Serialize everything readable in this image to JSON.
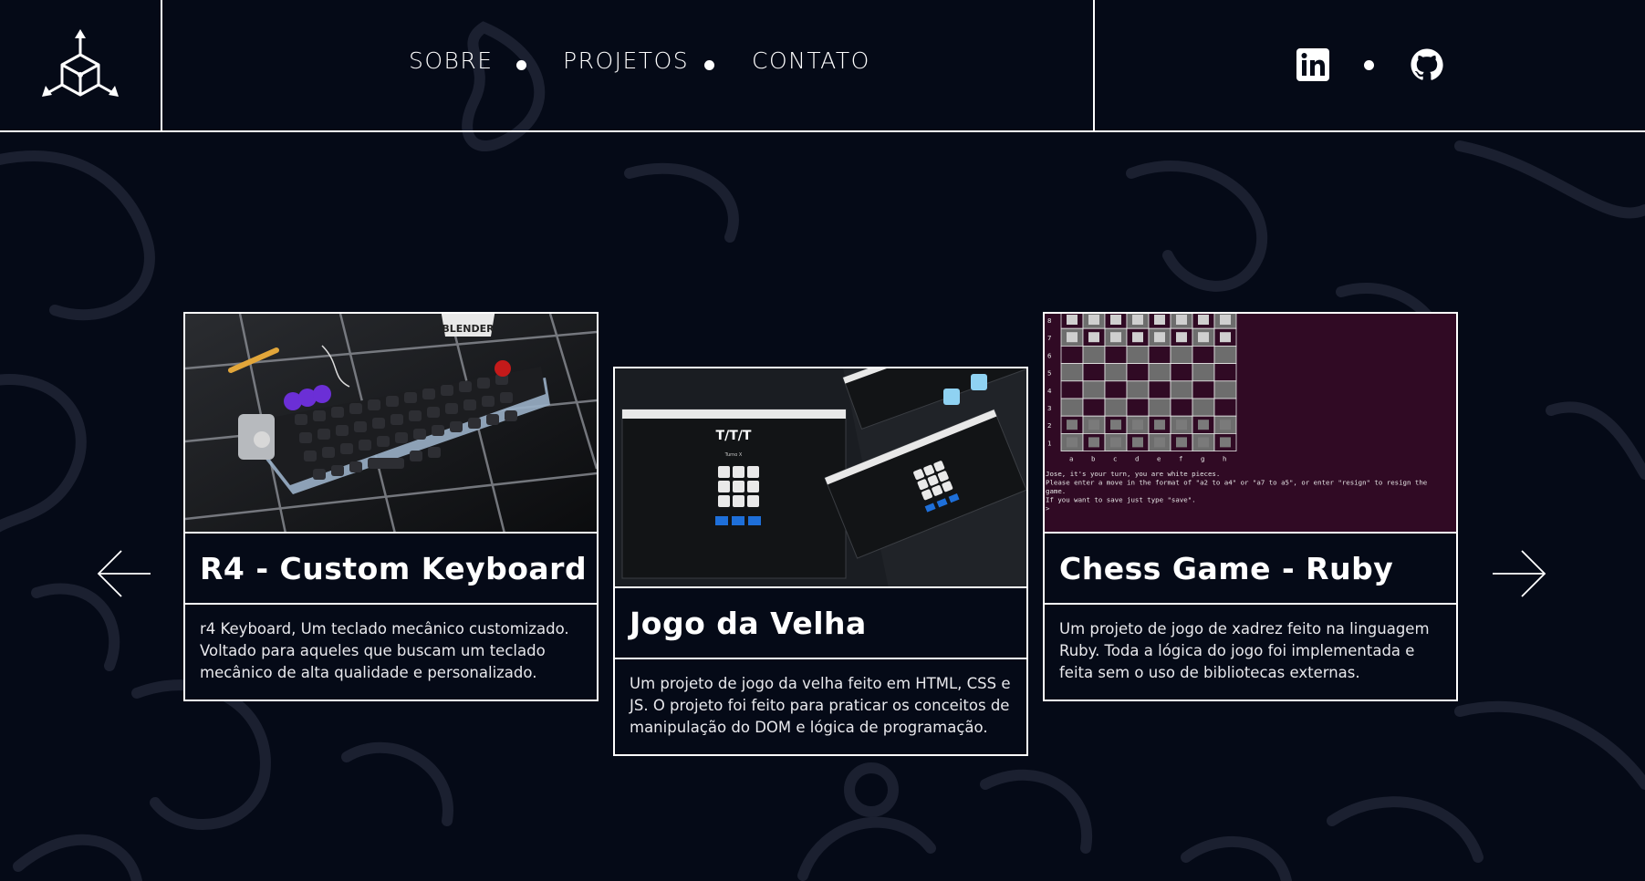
{
  "header": {
    "logo_icon": "cube-logo-icon",
    "nav": [
      {
        "label": "SOBRE"
      },
      {
        "label": "PROJETOS"
      },
      {
        "label": "CONTATO"
      }
    ],
    "social": [
      {
        "name": "linkedin-icon"
      },
      {
        "name": "github-icon"
      }
    ]
  },
  "carousel": {
    "prev_icon": "arrow-left-icon",
    "next_icon": "arrow-right-icon",
    "cards": [
      {
        "title": "R4 - Custom Keyboard",
        "description": "r4 Keyboard, Um teclado mecânico customizado. Voltado para aqueles que buscam um teclado mecânico de alta qualidade e personalizado.",
        "image_text": "BLENDER"
      },
      {
        "title": "Jogo da Velha",
        "description": "Um projeto de jogo da velha feito em HTML, CSS e JS. O projeto foi feito para praticar os conceitos de manipulação do DOM e lógica de programação.",
        "image_text": "T/T/T",
        "image_subtext": "Turno X"
      },
      {
        "title": "Chess Game - Ruby",
        "description": "Um projeto de jogo de xadrez feito na linguagem Ruby. Toda a lógica do jogo foi implementada e feita sem o uso de bibliotecas externas.",
        "image_lines": [
          "Jose, it's your turn, you are white pieces.",
          "Please enter a move in the format of \"a2 to a4\" or \"a7 to a5\", or enter \"resign\" to resign the",
          " game.",
          "If you want to save just type \"save\".",
          ">"
        ],
        "files": [
          "a",
          "b",
          "c",
          "d",
          "e",
          "f",
          "g",
          "h"
        ],
        "ranks": [
          "8",
          "7",
          "6",
          "5",
          "4",
          "3",
          "2",
          "1"
        ]
      }
    ]
  },
  "colors": {
    "background": "#050a17",
    "foreground": "#ffffff",
    "terminal": "#300a24"
  }
}
